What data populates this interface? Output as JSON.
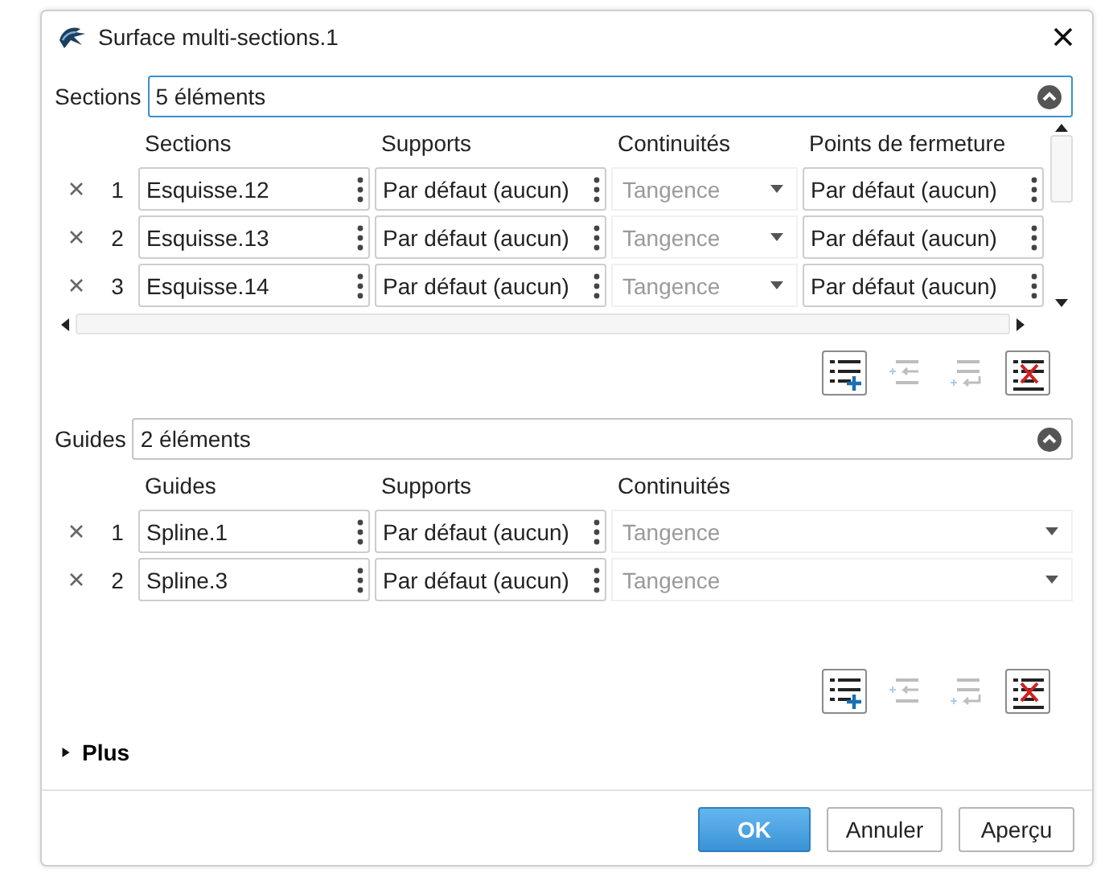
{
  "window": {
    "title": "Surface multi-sections.1"
  },
  "sections": {
    "label": "Sections",
    "field": "5 éléments",
    "columns": [
      "Sections",
      "Supports",
      "Continuités",
      "Points de fermeture"
    ],
    "rows": [
      {
        "index": "1",
        "cells": [
          "Esquisse.12",
          "Par défaut (aucun)",
          "Tangence",
          "Par défaut (aucun)"
        ]
      },
      {
        "index": "2",
        "cells": [
          "Esquisse.13",
          "Par défaut (aucun)",
          "Tangence",
          "Par défaut (aucun)"
        ]
      },
      {
        "index": "3",
        "cells": [
          "Esquisse.14",
          "Par défaut (aucun)",
          "Tangence",
          "Par défaut (aucun)"
        ]
      }
    ],
    "tools": [
      {
        "kind": "add",
        "disabled": false
      },
      {
        "kind": "insert-before",
        "disabled": true
      },
      {
        "kind": "insert-after",
        "disabled": true
      },
      {
        "kind": "remove",
        "disabled": false
      }
    ]
  },
  "guides": {
    "label": "Guides",
    "field": "2 éléments",
    "columns": [
      "Guides",
      "Supports",
      "Continuités"
    ],
    "rows": [
      {
        "index": "1",
        "cells": [
          "Spline.1",
          "Par défaut (aucun)",
          "Tangence"
        ]
      },
      {
        "index": "2",
        "cells": [
          "Spline.3",
          "Par défaut (aucun)",
          "Tangence"
        ]
      }
    ],
    "tools": [
      {
        "kind": "add",
        "disabled": false
      },
      {
        "kind": "insert-before",
        "disabled": true
      },
      {
        "kind": "insert-after",
        "disabled": true
      },
      {
        "kind": "remove",
        "disabled": false
      }
    ]
  },
  "plus": {
    "label": "Plus",
    "expanded": false
  },
  "buttons": [
    {
      "label": "OK",
      "kind": "primary"
    },
    {
      "label": "Annuler",
      "kind": "normal"
    },
    {
      "label": "Aperçu",
      "kind": "normal"
    }
  ]
}
